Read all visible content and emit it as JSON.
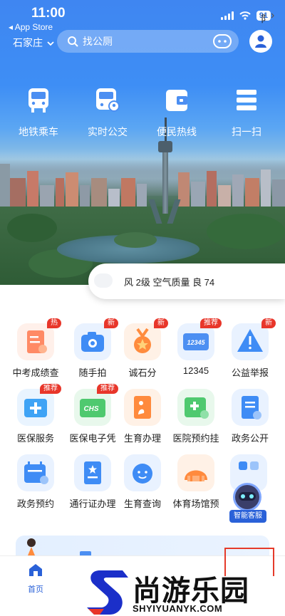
{
  "status_bar": {
    "time": "11:00",
    "back_app": "◂ App Store",
    "battery": "91"
  },
  "top_bar": {
    "city": "石家庄",
    "search_placeholder": "找公厕"
  },
  "quick_entries": [
    {
      "label": "地铁乘车",
      "icon": "bus-icon"
    },
    {
      "label": "实时公交",
      "icon": "bus-location-icon"
    },
    {
      "label": "便民热线",
      "icon": "wallet-icon"
    },
    {
      "label": "扫一扫",
      "icon": "scan-icon"
    }
  ],
  "weather": {
    "text": "风 2级 空气质量 良 74",
    "more": "阝"
  },
  "services": [
    {
      "label": "中考成绩查",
      "icon": "certificate-icon",
      "badge": "热",
      "color": "#ff8a65"
    },
    {
      "label": "随手拍",
      "icon": "camera-icon",
      "badge": "新",
      "color": "#3f8cf5"
    },
    {
      "label": "诚石分",
      "icon": "medal-icon",
      "badge": "新",
      "color": "#ff8b3d"
    },
    {
      "label": "12345",
      "icon": "hotline-card-icon",
      "badge": "推荐",
      "color": "#4c8ff2"
    },
    {
      "label": "公益举报",
      "icon": "warning-icon",
      "badge": "新",
      "color": "#3f8cf5"
    },
    {
      "label": "医保服务",
      "icon": "medical-box-icon",
      "badge": "推荐",
      "color": "#3fa3f5"
    },
    {
      "label": "医保电子凭",
      "icon": "chs-card-icon",
      "badge": "推荐",
      "color": "#4fc96f"
    },
    {
      "label": "生育办理",
      "icon": "maternity-doc-icon",
      "badge": "",
      "color": "#ff8a3d"
    },
    {
      "label": "医院预约挂",
      "icon": "hospital-calendar-icon",
      "badge": "",
      "color": "#4fc96f"
    },
    {
      "label": "政务公开",
      "icon": "clipboard-icon",
      "badge": "",
      "color": "#3f8cf5"
    },
    {
      "label": "政务预约",
      "icon": "calendar-icon",
      "badge": "",
      "color": "#3f8cf5"
    },
    {
      "label": "通行证办理",
      "icon": "pass-doc-icon",
      "badge": "",
      "color": "#3f8cf5"
    },
    {
      "label": "生育查询",
      "icon": "baby-face-icon",
      "badge": "",
      "color": "#3f8cf5"
    },
    {
      "label": "体育场馆预",
      "icon": "stadium-icon",
      "badge": "",
      "color": "#ff8a3d"
    }
  ],
  "assistant": {
    "label": "智能客服"
  },
  "tabbar": {
    "home": "首页"
  },
  "watermark": {
    "cn": "尚游乐园",
    "en": "SHYIYUANYK.COM"
  }
}
